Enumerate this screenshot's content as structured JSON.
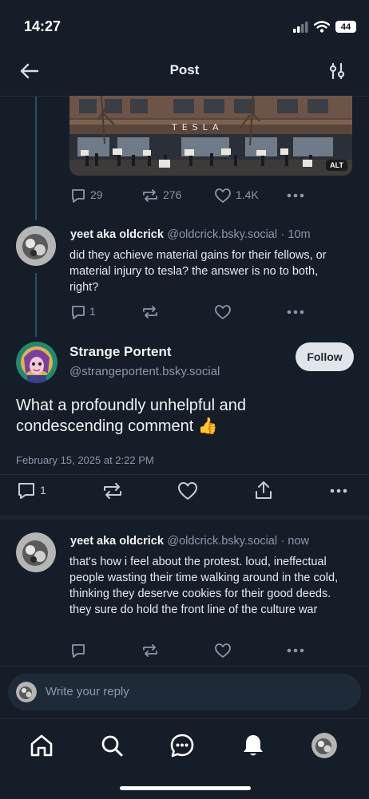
{
  "status_bar": {
    "time": "14:27",
    "battery": "44"
  },
  "header": {
    "title": "Post"
  },
  "icons": {
    "back": "arrow-left-icon",
    "filter": "sliders-icon",
    "reply": "speech-bubble-icon",
    "repost": "repost-icon",
    "like": "heart-icon",
    "more": "more-dots-icon",
    "share": "share-icon",
    "home": "home-icon",
    "search": "search-icon",
    "chat": "chat-icon",
    "notifications": "bell-icon"
  },
  "parent_post": {
    "image_alt_badge": "ALT",
    "image_sign_text": "TESLA",
    "reply_count": "29",
    "repost_count": "276",
    "like_count": "1.4K"
  },
  "reply_post": {
    "display_name": "yeet aka oldcrick",
    "handle": "@oldcrick.bsky.social",
    "time": "· 10m",
    "text": "did they achieve material gains for their fellows, or material injury to tesla? the answer is no to both, right?",
    "reply_count": "1"
  },
  "focused_post": {
    "display_name": "Strange Portent",
    "handle": "@strangeportent.bsky.social",
    "follow_label": "Follow",
    "text": "What a profoundly unhelpful and condescending comment 👍",
    "date": "February 15, 2025 at 2:22 PM",
    "reply_count": "1"
  },
  "latest_reply": {
    "display_name": "yeet aka oldcrick",
    "handle": "@oldcrick.bsky.social",
    "time": "· now",
    "text": "that's how i feel about the protest. loud, ineffectual people wasting their time walking around in the cold, thinking they deserve cookies for their good deeds. they sure do hold the front line of the culture war"
  },
  "composer": {
    "placeholder": "Write your reply"
  },
  "colors": {
    "background": "#151d28",
    "accent": "#2e4a6a",
    "muted": "#8a98ab"
  }
}
